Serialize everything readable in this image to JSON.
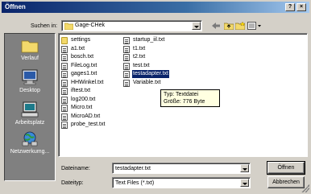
{
  "window": {
    "title": "Öffnen",
    "help_label": "?",
    "close_label": "×"
  },
  "lookin": {
    "label": "Suchen in:",
    "value": "Gage-CHek"
  },
  "places": [
    {
      "label": "Verlauf",
      "icon": "history-folder-icon"
    },
    {
      "label": "Desktop",
      "icon": "desktop-icon"
    },
    {
      "label": "Arbeitsplatz",
      "icon": "my-computer-icon"
    },
    {
      "label": "Netzwerkumg...",
      "icon": "network-icon"
    }
  ],
  "files": {
    "col1": [
      {
        "name": "settings",
        "type": "folder"
      },
      {
        "name": "a1.txt",
        "type": "txt"
      },
      {
        "name": "bosch.txt",
        "type": "txt"
      },
      {
        "name": "FileLog.txt",
        "type": "txt"
      },
      {
        "name": "gages1.txt",
        "type": "txt"
      },
      {
        "name": "HHWinkel.txt",
        "type": "txt"
      },
      {
        "name": "iftest.txt",
        "type": "txt"
      },
      {
        "name": "log200.txt",
        "type": "txt"
      },
      {
        "name": "Micro.txt",
        "type": "txt"
      },
      {
        "name": "MicroAD.txt",
        "type": "txt"
      },
      {
        "name": "probe_test.txt",
        "type": "txt"
      }
    ],
    "col2": [
      {
        "name": "startup_iil.txt",
        "type": "txt"
      },
      {
        "name": "t1.txt",
        "type": "txt"
      },
      {
        "name": "t2.txt",
        "type": "txt"
      },
      {
        "name": "test.txt",
        "type": "txt"
      },
      {
        "name": "testadapter.txt",
        "type": "txt",
        "selected": true
      },
      {
        "name": "Variable.txt",
        "type": "txt"
      }
    ]
  },
  "tooltip": {
    "line1": "Typ: Textdatei",
    "line2": "Größe: 776 Byte"
  },
  "filename": {
    "label": "Dateiname:",
    "value": "testadapter.txt"
  },
  "filetype": {
    "label": "Dateityp:",
    "value": "Text Files (*.txt)"
  },
  "buttons": {
    "open": "Öffnen",
    "cancel": "Abbrechen"
  },
  "colors": {
    "title_start": "#0a246a",
    "title_end": "#a6caf0",
    "face": "#d4d0c8",
    "selection": "#0a246a"
  }
}
